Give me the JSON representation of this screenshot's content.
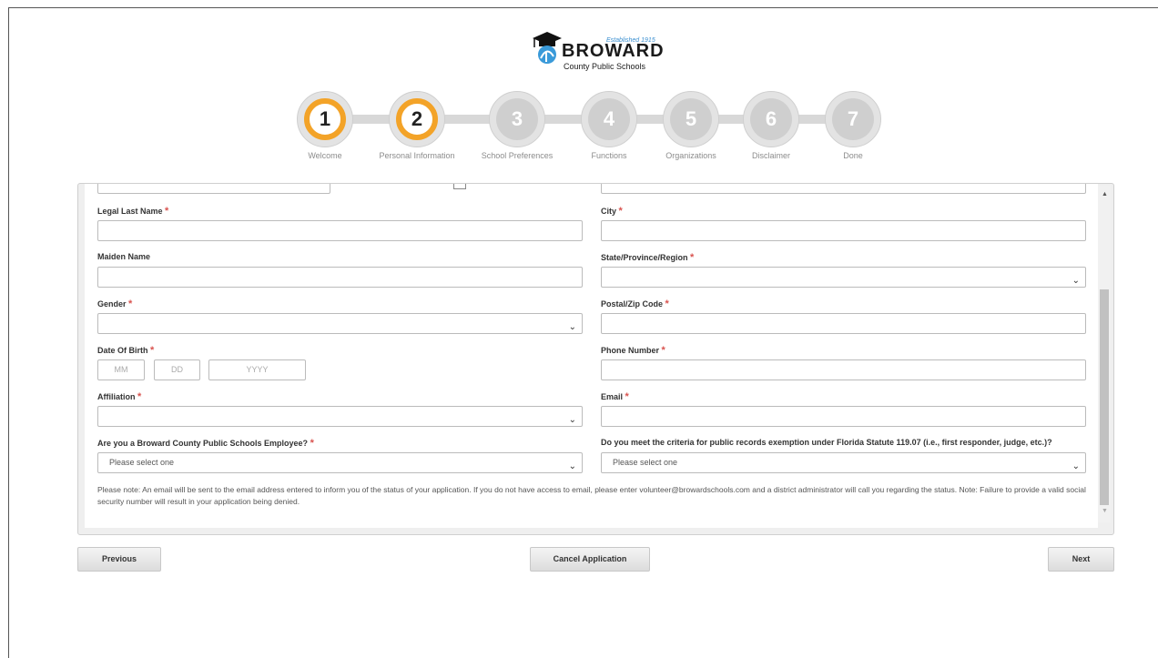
{
  "logo": {
    "established": "Established 1915",
    "brand": "BROWARD",
    "subtitle": "County Public Schools"
  },
  "steps": [
    {
      "number": "1",
      "label": "Welcome",
      "active": true
    },
    {
      "number": "2",
      "label": "Personal Information",
      "active": true
    },
    {
      "number": "3",
      "label": "School Preferences",
      "active": false
    },
    {
      "number": "4",
      "label": "Functions",
      "active": false
    },
    {
      "number": "5",
      "label": "Organizations",
      "active": false
    },
    {
      "number": "6",
      "label": "Disclaimer",
      "active": false
    },
    {
      "number": "7",
      "label": "Done",
      "active": false
    }
  ],
  "form": {
    "legal_last_name": "Legal Last Name",
    "maiden_name": "Maiden Name",
    "gender": "Gender",
    "dob": "Date Of Birth",
    "dob_mm": "MM",
    "dob_dd": "DD",
    "dob_yyyy": "YYYY",
    "affiliation": "Affiliation",
    "employee_q": "Are you a Broward County Public Schools Employee?",
    "employee_value": "Please select one",
    "city": "City",
    "state": "State/Province/Region",
    "zip": "Postal/Zip Code",
    "phone": "Phone Number",
    "email": "Email",
    "exemption_q": "Do you meet the criteria for public records exemption under Florida Statute 119.07 (i.e., first responder, judge, etc.)?",
    "exemption_value": "Please select one",
    "required_mark": "*",
    "note": "Please note: An email will be sent to the email address entered to inform you of the status of your application.  If you do not have access to email, please enter volunteer@browardschools.com and a district administrator will call you regarding the status. Note: Failure to provide a valid social security number will result in your application being denied."
  },
  "buttons": {
    "previous": "Previous",
    "cancel": "Cancel Application",
    "next": "Next"
  },
  "colors": {
    "accent": "#f3a328",
    "required": "#d9534f",
    "step_inactive": "#cfcfcf"
  }
}
